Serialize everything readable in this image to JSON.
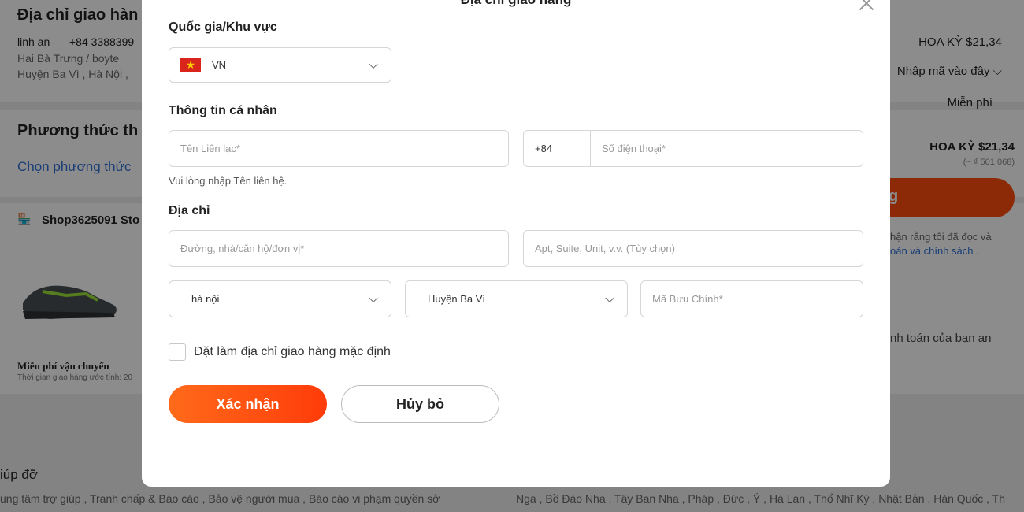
{
  "background": {
    "address_heading": "Địa chỉ giao hàn",
    "contact_name": "linh an",
    "contact_phone": "+84 3388399",
    "address_line1": "Hai Bà Trưng / boyte",
    "address_line2": "Huyện Ba Vì , Hà Nội ,",
    "method_heading": "Phương thức th",
    "method_link": "Chọn phương thức",
    "shop_name": "Shop3625091 Sto",
    "free_shipping": "Miễn phí vận chuyển",
    "delivery_time": "Thời gian giao hàng ước tính: 20",
    "help_heading": "iúp đỡ",
    "help_links": "ung tâm trợ giúp , Tranh chấp & Báo cáo , Bảo vệ người mua , Báo cáo vi phạm quyền sở",
    "countries": "Nga , Bồ Đào Nha , Tây Ban Nha , Pháp , Đức , Ý , Hà Lan , Thổ Nhĩ Kỳ , Nhật Bản , Hàn Quốc , Th",
    "price_top": "HOA KỲ $21,34",
    "coupon_placeholder": "Nhập mã vào đây",
    "shipping_fee": "Miễn phí",
    "total_price": "HOA KỲ $21,34",
    "total_vnd": "(~ ₫ 501,068)",
    "order_btn_partial": "g",
    "terms_line1": "hận rằng tôi đã đọc và",
    "terms_line2": "oản và chính sách .",
    "secure_text": "nh toán của bạn an"
  },
  "modal": {
    "title": "Địa chỉ giao hàng",
    "country_label": "Quốc gia/Khu vực",
    "country_value": "VN",
    "personal_label": "Thông tin cá nhân",
    "contact_placeholder": "Tên Liên lạc*",
    "phone_code": "+84",
    "phone_placeholder": "Số điện thoại*",
    "contact_hint": "Vui lòng nhập Tên liên hệ.",
    "address_label": "Địa chỉ",
    "street_placeholder": "Đường, nhà/căn hộ/đơn vị*",
    "apt_placeholder": "Apt, Suite, Unit, v.v. (Tùy chọn)",
    "province_value": "hà nội",
    "district_value": "Huyện Ba Vì",
    "postal_placeholder": "Mã Bưu Chính*",
    "default_checkbox_label": "Đặt làm địa chỉ giao hàng mặc định",
    "confirm_label": "Xác nhận",
    "cancel_label": "Hủy bỏ"
  },
  "colors": {
    "accent": "#ff4e0f",
    "overlay": "rgba(0,0,0,0.45)"
  }
}
